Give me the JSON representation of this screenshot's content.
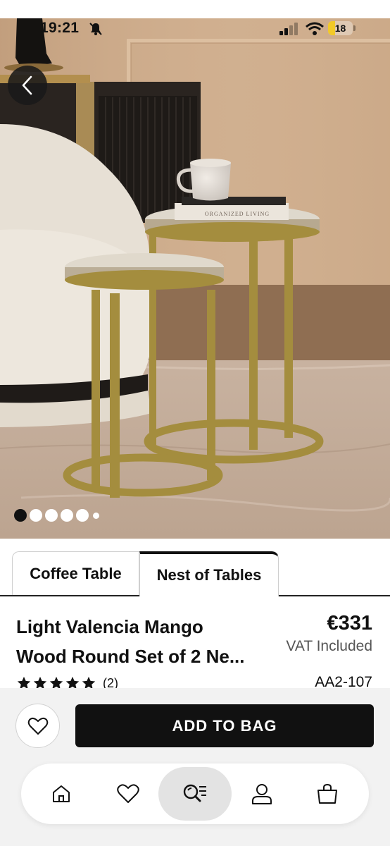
{
  "status_bar": {
    "time": "19:21",
    "battery_level": "18",
    "icons": [
      "bell-slash-icon",
      "signal-icon",
      "wifi-icon",
      "battery-icon"
    ]
  },
  "hero": {
    "book_title": "ORGANIZED LIVING",
    "image_index": 0,
    "image_count": 6
  },
  "tabs": [
    {
      "label": "Coffee Table",
      "selected": false
    },
    {
      "label": "Nest of Tables",
      "selected": true
    }
  ],
  "product": {
    "title_line1": "Light Valencia Mango",
    "title_line2": "Wood Round Set of 2 Ne...",
    "price": "€331",
    "vat_note": "VAT Included",
    "rating": 5,
    "rating_count": "(2)",
    "sku": "AA2-107"
  },
  "actions": {
    "add_to_bag_label": "ADD TO BAG"
  },
  "bottom_nav": {
    "items": [
      "home-icon",
      "heart-icon",
      "search-list-icon",
      "profile-icon",
      "bag-icon"
    ],
    "active_index": 2
  },
  "colors": {
    "accent": "#111111",
    "battery": "#f2c928",
    "table_frame": "#a48d3e"
  }
}
